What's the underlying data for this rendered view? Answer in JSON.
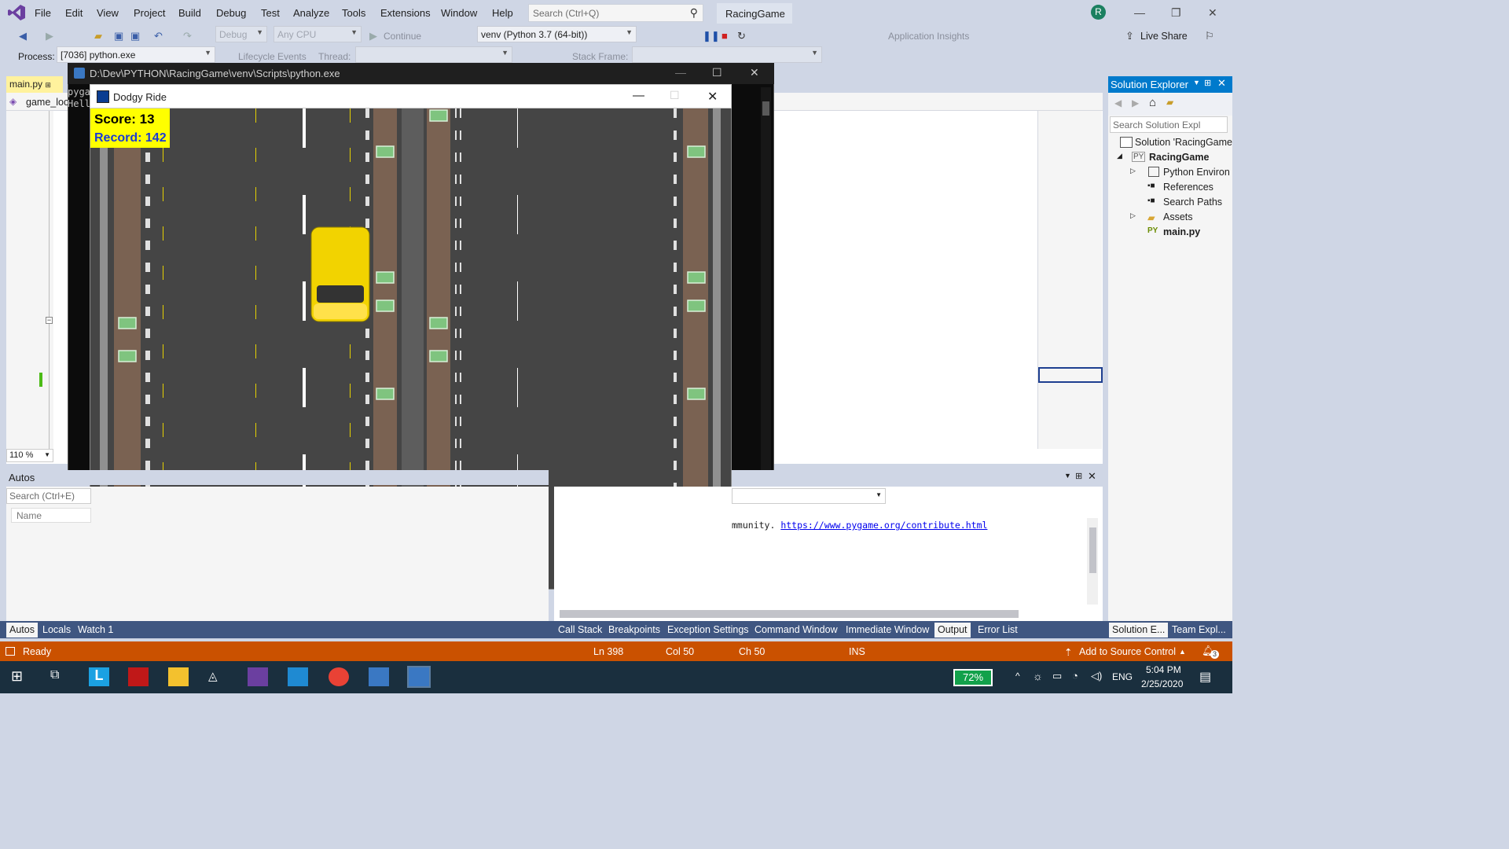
{
  "menubar": {
    "items": [
      "File",
      "Edit",
      "View",
      "Project",
      "Build",
      "Debug",
      "Test",
      "Analyze",
      "Tools",
      "Extensions",
      "Window",
      "Help"
    ],
    "search_placeholder": "Search (Ctrl+Q)",
    "solution_name": "RacingGame",
    "avatar_initial": "R"
  },
  "toolbar": {
    "config": "Debug",
    "platform": "Any CPU",
    "continue_label": "Continue",
    "environment": "venv (Python 3.7 (64-bit))",
    "app_insights": "Application Insights",
    "live_share": "Live Share",
    "process_label": "Process:",
    "process_value": "[7036] python.exe",
    "lifecycle_label": "Lifecycle Events",
    "thread_label": "Thread:",
    "stack_frame_label": "Stack Frame:"
  },
  "editor": {
    "tab_label": "main.py",
    "nav_label": "game_loo",
    "zoom": "110 %"
  },
  "console": {
    "title": "D:\\Dev\\PYTHON\\RacingGame\\venv\\Scripts\\python.exe",
    "line1": "pyga",
    "line2": "Hell"
  },
  "game": {
    "title": "Dodgy Ride",
    "score": "Score: 13",
    "record": "Record: 142"
  },
  "solution_explorer": {
    "title": "Solution Explorer",
    "search_placeholder": "Search Solution Expl",
    "items": [
      "Solution 'RacingGame",
      "RacingGame",
      "Python Environ",
      "References",
      "Search Paths",
      "Assets",
      "main.py"
    ]
  },
  "autos": {
    "title": "Autos",
    "search_placeholder": "Search (Ctrl+E)",
    "column_name": "Name"
  },
  "output": {
    "text": "mmunity. ",
    "link": "https://www.pygame.org/contribute.html"
  },
  "bottom_tabs_left": [
    "Autos",
    "Locals",
    "Watch 1"
  ],
  "bottom_tabs_right": [
    "Call Stack",
    "Breakpoints",
    "Exception Settings",
    "Command Window",
    "Immediate Window",
    "Output",
    "Error List"
  ],
  "bottom_tabs_se": [
    "Solution E...",
    "Team Expl..."
  ],
  "statusbar": {
    "ready": "Ready",
    "ln": "Ln 398",
    "col": "Col 50",
    "ch": "Ch 50",
    "ins": "INS",
    "source_control": "Add to Source Control",
    "notifications": "3"
  },
  "taskbar": {
    "battery": "72%",
    "lang": "ENG",
    "time": "5:04 PM",
    "date": "2/25/2020"
  },
  "colors": {
    "accent": "#007acc",
    "status": "#ca5100",
    "score_bg": "#ffff00",
    "record": "#1a3ad6"
  }
}
